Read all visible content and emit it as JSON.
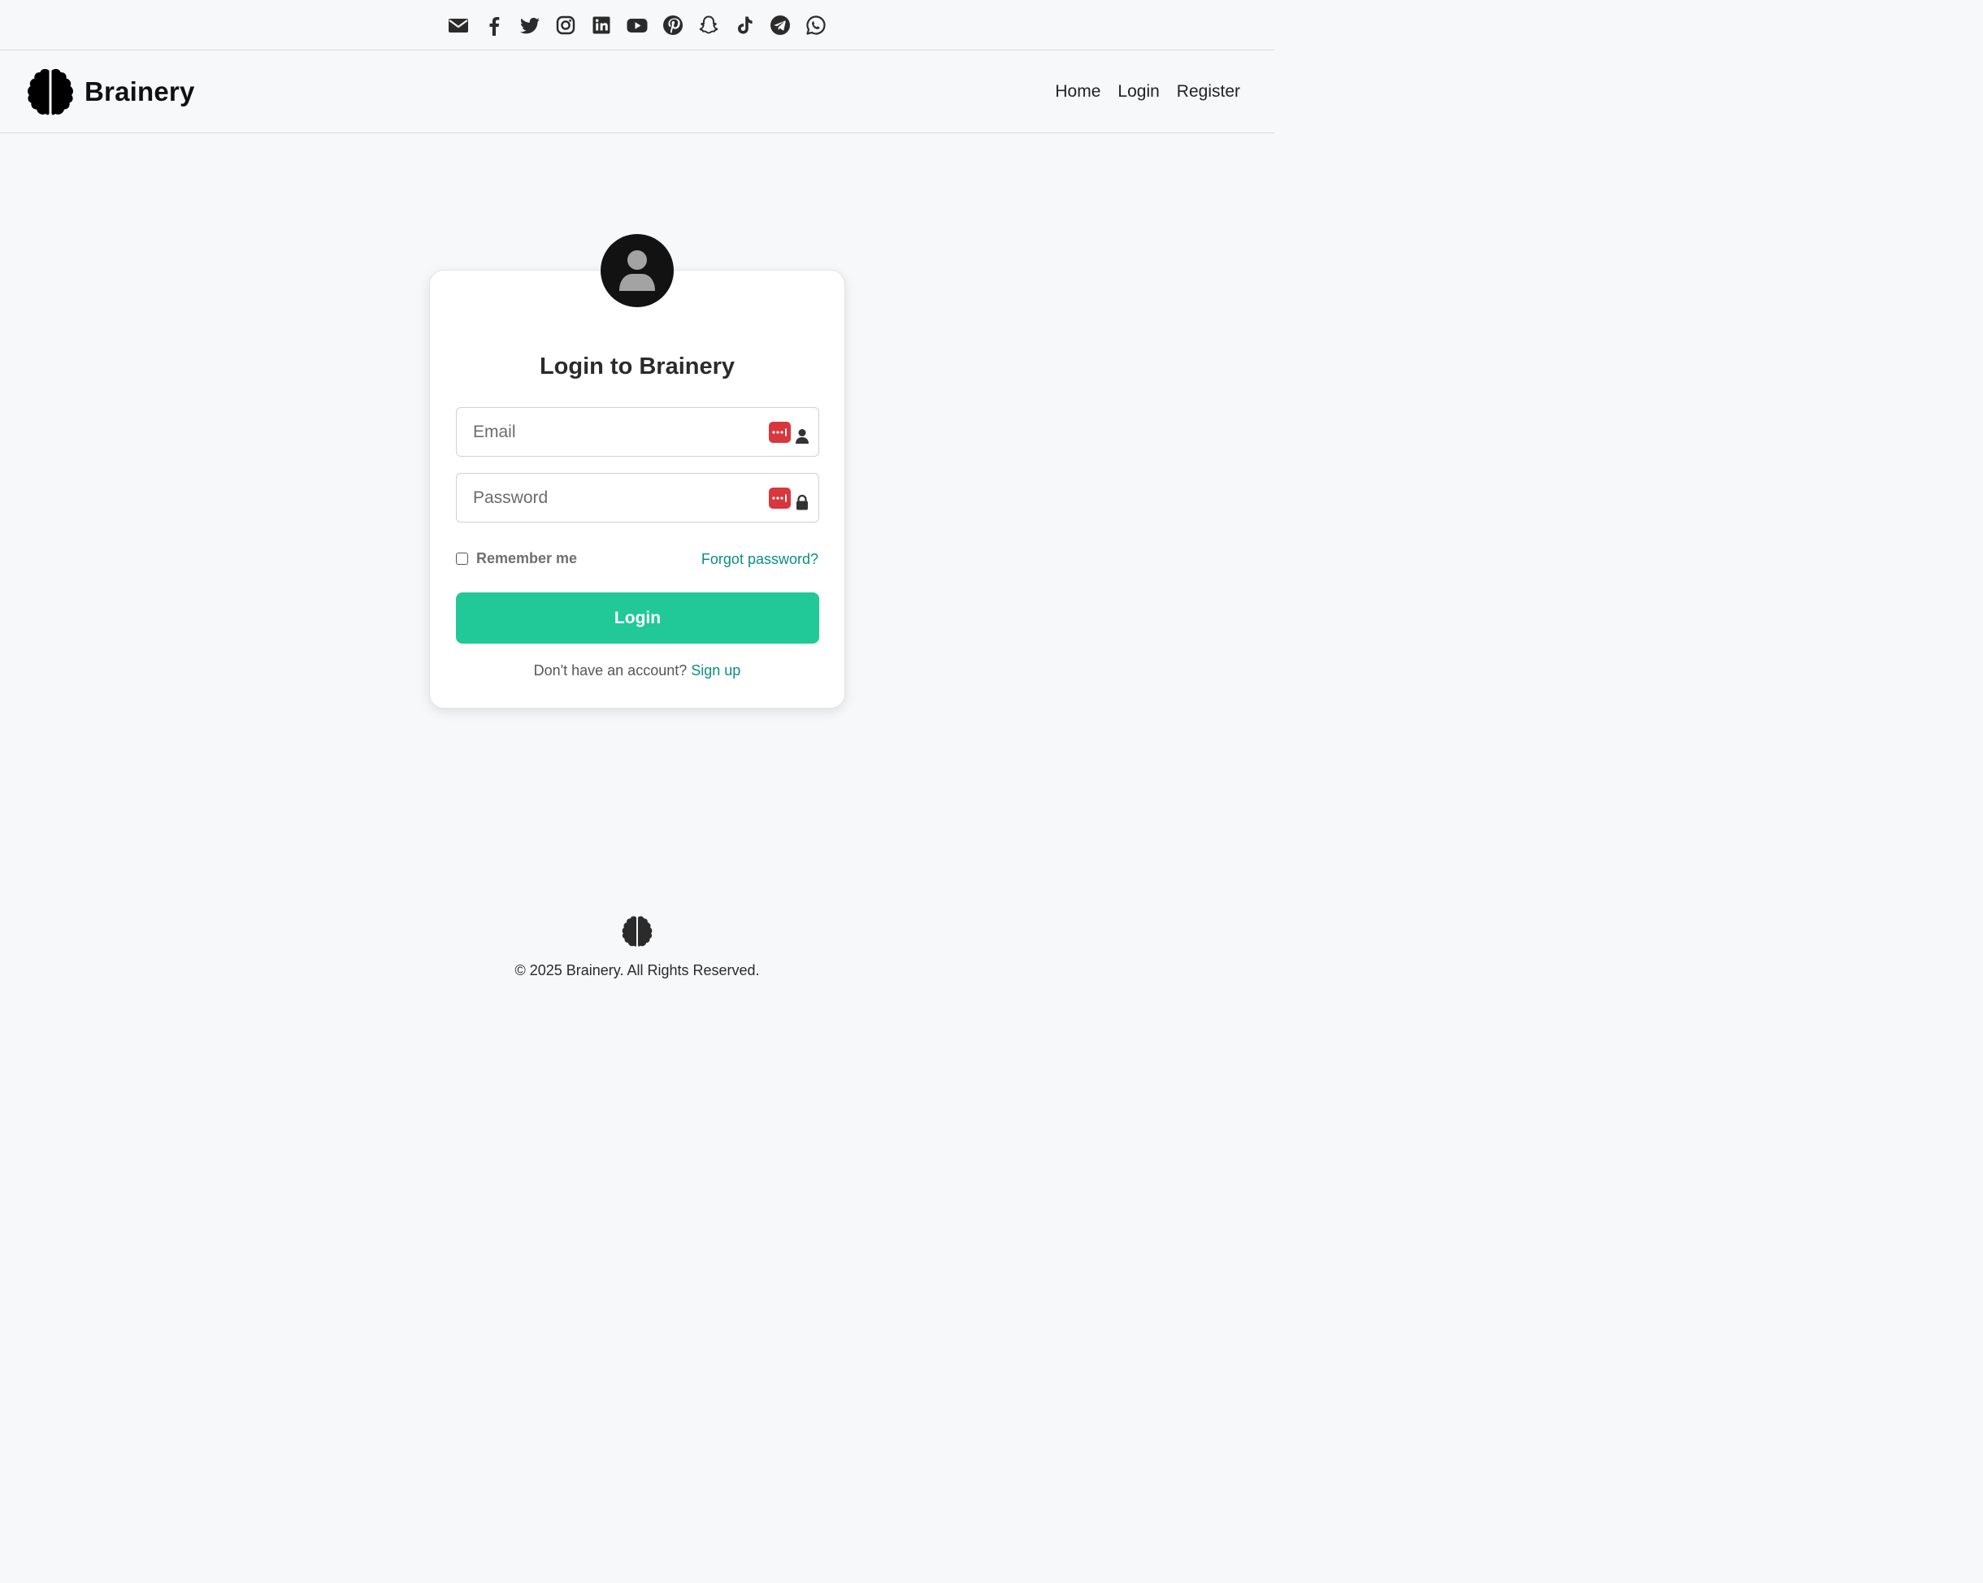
{
  "social": {
    "icons": [
      "envelope-icon",
      "facebook-icon",
      "twitter-icon",
      "instagram-icon",
      "linkedin-icon",
      "youtube-icon",
      "pinterest-icon",
      "snapchat-icon",
      "tiktok-icon",
      "telegram-icon",
      "whatsapp-icon"
    ]
  },
  "header": {
    "brand_name": "Brainery",
    "logo_icon": "brain-icon",
    "nav": {
      "home": "Home",
      "login": "Login",
      "register": "Register"
    }
  },
  "login_card": {
    "avatar_icon": "user-circle-icon",
    "title": "Login to Brainery",
    "email": {
      "placeholder": "Email",
      "value": "",
      "icon": "user-icon",
      "password_manager_icon": "password-manager-icon"
    },
    "password": {
      "placeholder": "Password",
      "value": "",
      "icon": "lock-icon",
      "password_manager_icon": "password-manager-icon"
    },
    "remember_label": "Remember me",
    "remember_checked": false,
    "forgot_label": "Forgot password?",
    "submit_label": "Login",
    "signup_prompt": "Don't have an account?",
    "signup_link": "Sign up"
  },
  "footer": {
    "logo_icon": "brain-icon",
    "copyright": "© 2025 Brainery. All Rights Reserved."
  },
  "colors": {
    "accent": "#20c997",
    "link": "#0a8f7e",
    "password_manager": "#d9363e",
    "background": "#f7f8fa"
  }
}
